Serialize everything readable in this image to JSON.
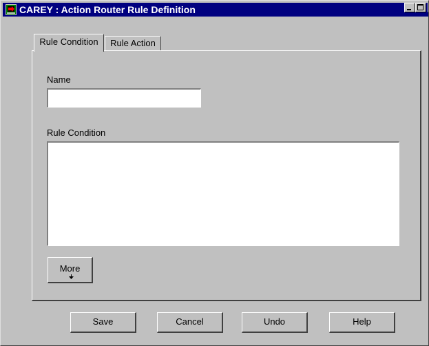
{
  "window": {
    "title": "CAREY : Action Router Rule Definition"
  },
  "icons": {
    "app": "app-icon",
    "minimize": "minimize-icon",
    "maximize": "maximize-icon",
    "close": "close-icon",
    "more": "chevron-down-icon"
  },
  "tabs": [
    {
      "label": "Rule Condition",
      "selected": true
    },
    {
      "label": "Rule Action",
      "selected": false
    }
  ],
  "form": {
    "name_label": "Name",
    "name_value": "",
    "condition_label": "Rule Condition",
    "condition_value": "",
    "more_label": "More"
  },
  "buttons": {
    "save": "Save",
    "cancel": "Cancel",
    "undo": "Undo",
    "help": "Help"
  },
  "colors": {
    "titlebar": "#000080",
    "face": "#c0c0c0",
    "field": "#ffffff"
  }
}
